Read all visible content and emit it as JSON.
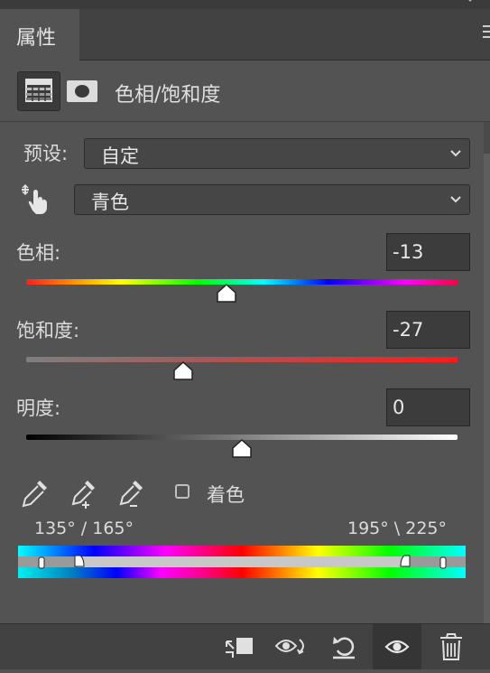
{
  "panel": {
    "tab_label": "属性"
  },
  "header": {
    "title": "色相/饱和度",
    "adjustment_icon": "hue-saturation-icon",
    "mask_icon": "mask-icon"
  },
  "preset": {
    "label": "预设:",
    "value": "自定"
  },
  "channel": {
    "value": "青色",
    "icon": "targeted-adjustment-hand-icon"
  },
  "hue": {
    "label": "色相:",
    "value": "-13",
    "range": [
      -180,
      180
    ]
  },
  "saturation": {
    "label": "饱和度:",
    "value": "-27",
    "range": [
      -100,
      100
    ]
  },
  "lightness": {
    "label": "明度:",
    "value": "0",
    "range": [
      -100,
      100
    ]
  },
  "tools": {
    "icons": [
      "eyedropper-icon",
      "eyedropper-plus-icon",
      "eyedropper-minus-icon"
    ],
    "colorize_label": "着色",
    "colorize_checked": false
  },
  "range_readout": {
    "left": "135° /  165°",
    "right": "195° \\  225°"
  },
  "bottom_bar": {
    "icons": [
      "clip-to-layer-icon",
      "view-previous-state-icon",
      "reset-icon",
      "visibility-eye-icon",
      "trash-icon"
    ]
  },
  "colors": {
    "panel_bg": "#535353",
    "dark_bg": "#424242",
    "field_bg": "#3c3c3c"
  }
}
